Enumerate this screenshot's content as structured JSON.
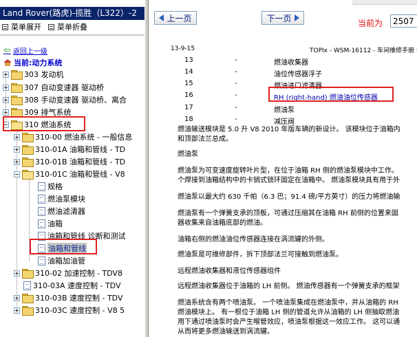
{
  "left_pane": {
    "title": "Land Rover(路虎)-揽胜（L322）-2",
    "menu": {
      "expand": "菜单展开",
      "collapse": "菜单折叠"
    },
    "back_link": "返回上一级",
    "current_label": "当前:动力系统",
    "tree": [
      {
        "label": "303 发动机"
      },
      {
        "label": "307 自动变速器 驱动桥"
      },
      {
        "label": "308 手动变速器 驱动桥、离合"
      },
      {
        "label": "309 排气系统"
      },
      {
        "label": "310 燃油系统"
      },
      {
        "label": "310-00 燃油系统 - 一般信息"
      },
      {
        "label": "310-01A 油箱和管线 - TD"
      },
      {
        "label": "310-01B 油箱和管线 - TD"
      },
      {
        "label": "310-01C 油箱和管线 - V8"
      },
      {
        "label": "规格"
      },
      {
        "label": "燃油泵模块"
      },
      {
        "label": "燃油滤清器"
      },
      {
        "label": "油箱"
      },
      {
        "label": "油箱和管线 诊断和测试"
      },
      {
        "label": "油箱和管线"
      },
      {
        "label": "油箱加油管"
      },
      {
        "label": "310-02 加速控制 - TDV8"
      },
      {
        "label": "310-03A 速度控制 - TDV"
      },
      {
        "label": "310-03B 速度控制 - TDV"
      },
      {
        "label": "310-03C 速度控制 - V8 5"
      }
    ]
  },
  "nav": {
    "prev": "上一页",
    "next": "下一页",
    "current_page_label": "当前为",
    "current_page": "2507"
  },
  "doc": {
    "header_left": "13-9-15",
    "header_right": "TOPIx - WSM-16112 - 车间维修手册 R",
    "items": [
      {
        "num": "13",
        "dash": "-",
        "text": "燃油收集器"
      },
      {
        "num": "14",
        "dash": "-",
        "text": "油位传感器浮子"
      },
      {
        "num": "15",
        "dash": "-",
        "text": "燃油进口滤清器"
      },
      {
        "num": "16",
        "dash": "-",
        "text": "RH (right-hand) 燃油油位传感器"
      },
      {
        "num": "17",
        "dash": "-",
        "text": "燃油泵"
      },
      {
        "num": "18",
        "dash": "-",
        "text": "减压阀"
      }
    ],
    "p1a": "燃油输送模块是 5.0 升 V8 2010 年版车辆的新设计。 该模块位于油箱内",
    "p1b": "和顶部法兰总成。",
    "h_pump": "燃油泵",
    "p2a": "燃油泵为可变速度旋转叶片型，在位于油箱 RH 侧的燃油泵模块中工作。",
    "p2b": "个焊接到油箱结构中的卡销式锁环固定在油箱中。 燃油泵模块具有用于外",
    "p3": "燃油泵以最大约 630 千帕（6.3 巴；91.4 磅/平方英寸）的压力将燃油输",
    "p4a": "燃油泵有一个弹簧支承的顶板，可通过压缩其在油箱 RH 前侧的位置来固",
    "p4b": "器收集来自油箱底部的燃油。",
    "p5": "油箱右侧的燃油油位传感器连接在涡流罐的外侧。",
    "p6": "燃油泵是可维修部件，拆下顶部法兰可接触到燃油泵。",
    "h_remote": "远程燃油收集器和液位传感器组件",
    "p7": "远程燃油收集器位于油箱的 LH 前侧。 燃油传感器有一个弹簧支承的框架",
    "p8a": "燃油系统含有两个喷油泵。 一个喷油泵集成在燃油泵中，并从油箱的 RH",
    "p8b": "燃油模块上。 有一根位于油箱 LH 侧的管道允许从油箱的 LH 侧抽取燃油",
    "p8c": "用下通过喷油泵时会产生喉管效应，喷油泵根据这一效应工作。 这可以通",
    "p8d": "从而将更多燃油输送到涡流罐。"
  },
  "colors": {
    "title_bg": "#0a246a",
    "highlight": "#e02020",
    "link": "#0000cc"
  }
}
